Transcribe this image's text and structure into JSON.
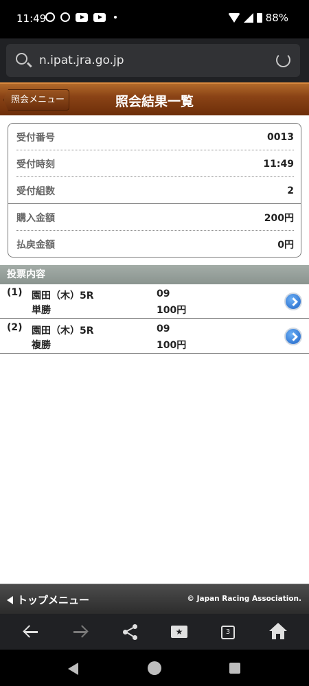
{
  "status_bar": {
    "time": "11:49",
    "battery": "88%"
  },
  "browser": {
    "url": "n.ipat.jra.go.jp"
  },
  "header": {
    "back_label": "照会メニュー",
    "title": "照会結果一覧"
  },
  "summary": {
    "rows": [
      {
        "label": "受付番号",
        "value": "0013"
      },
      {
        "label": "受付時刻",
        "value": "11:49"
      },
      {
        "label": "受付組数",
        "value": "2"
      },
      {
        "label": "購入金額",
        "value": "200円"
      },
      {
        "label": "払戻金額",
        "value": "0円"
      }
    ]
  },
  "bets": {
    "section_title": "投票内容",
    "items": [
      {
        "num": "(1)",
        "race": "園田（木）5R",
        "type": "単勝",
        "horse": "09",
        "amount": "100円"
      },
      {
        "num": "(2)",
        "race": "園田（木）5R",
        "type": "複勝",
        "horse": "09",
        "amount": "100円"
      }
    ]
  },
  "footer": {
    "top_menu": "トップメニュー",
    "copyright": "© Japan Racing Association."
  },
  "toolbar": {
    "tab_count": "3"
  },
  "colors": {
    "header_brown": "#8a4316",
    "section_gray": "#8a948f",
    "arrow_blue": "#1d63c7"
  }
}
